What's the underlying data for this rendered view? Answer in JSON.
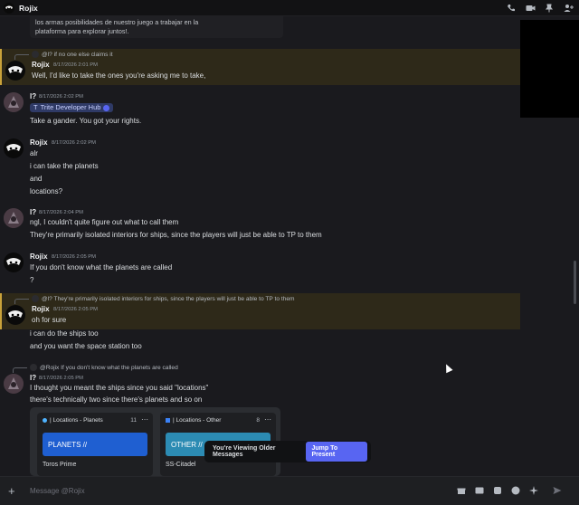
{
  "window": {
    "title": "Rojix"
  },
  "previous_card": {
    "line1": "los armas posibilidades de nuestro juego a trabajar en la",
    "line2": "plataforma para explorar juntos!."
  },
  "messages": [
    {
      "reply": "@l? if no one else claims it",
      "author": "Rojix",
      "time": "8/17/2026 2:01 PM",
      "lines": [
        "Well, I'd like to take the ones you're asking me to take,"
      ]
    },
    {
      "author": "l?",
      "time": "8/17/2026 2:02 PM",
      "channel": "Trite Developer Hub",
      "lines": [
        "Take a gander. You got your rights."
      ]
    },
    {
      "author": "Rojix",
      "time": "8/17/2026 2:02 PM",
      "lines": [
        "alr",
        "i can take the planets",
        "and",
        "locations?"
      ]
    },
    {
      "author": "l?",
      "time": "8/17/2026 2:04 PM",
      "lines": [
        "ngl, I couldn't quite figure out what to call them",
        "They're primarily isolated interiors for ships, since the players will just be able to TP to them"
      ]
    },
    {
      "author": "Rojix",
      "time": "8/17/2026 2:05 PM",
      "lines": [
        "If you don't know what the planets are called",
        "?"
      ]
    },
    {
      "reply": "@l? They're primarily isolated interiors for ships, since the players will just be able to TP to them",
      "author": "Rojix",
      "time": "8/17/2026 2:05 PM",
      "lines": [
        "oh for sure",
        "i can do the ships too",
        "and you want the space station too"
      ]
    },
    {
      "reply": "@Rojix If you don't know what the planets are called",
      "author": "l?",
      "time": "8/17/2026 2:05 PM",
      "lines": [
        "I thought you meant the ships since you said \"locations\"",
        "there's technically two since there's planets and so on"
      ]
    }
  ],
  "embed": {
    "columns": [
      {
        "header": "| Locations - Planets",
        "count": "11",
        "bar": "PLANETS //",
        "item": "Toros Prime",
        "bar_color": "#1f5fd1"
      },
      {
        "header": "| Locations - Other",
        "count": "8",
        "bar": "OTHER //",
        "item": "SS-Citadel",
        "bar_color": "#2c8bb3"
      }
    ]
  },
  "older_banner": {
    "text": "You're Viewing Older Messages",
    "button": "Jump To Present"
  },
  "input": {
    "placeholder": "Message @Rojix"
  },
  "colors": {
    "accent": "#5865f2",
    "highlight": "#c9a23a"
  }
}
